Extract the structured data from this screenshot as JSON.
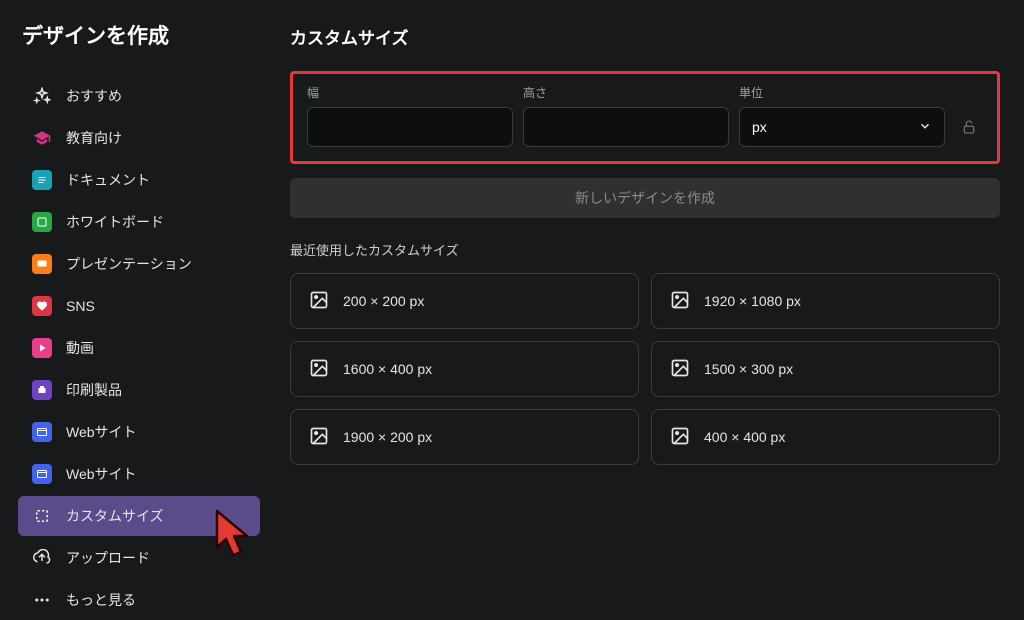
{
  "sidebar": {
    "title": "デザインを作成",
    "items": [
      {
        "label": "おすすめ",
        "icon": "sparkle",
        "color": "#e5e5e5"
      },
      {
        "label": "教育向け",
        "icon": "graduation",
        "color": "#d63384"
      },
      {
        "label": "ドキュメント",
        "icon": "document",
        "color": "#17a2b8"
      },
      {
        "label": "ホワイトボード",
        "icon": "whiteboard",
        "color": "#28a745"
      },
      {
        "label": "プレゼンテーション",
        "icon": "presentation",
        "color": "#fd7e14"
      },
      {
        "label": "SNS",
        "icon": "sns",
        "color": "#dc3545"
      },
      {
        "label": "動画",
        "icon": "video",
        "color": "#e83e8c"
      },
      {
        "label": "印刷製品",
        "icon": "print",
        "color": "#6f42c1"
      },
      {
        "label": "Webサイト",
        "icon": "website",
        "color": "#4263eb"
      },
      {
        "label": "Webサイト",
        "icon": "website",
        "color": "#4263eb"
      },
      {
        "label": "カスタムサイズ",
        "icon": "custom",
        "color": "#e5e5e5",
        "active": true
      },
      {
        "label": "アップロード",
        "icon": "upload",
        "color": "#e5e5e5"
      },
      {
        "label": "もっと見る",
        "icon": "more",
        "color": "#e5e5e5"
      }
    ]
  },
  "main": {
    "title": "カスタムサイズ",
    "fields": {
      "width_label": "幅",
      "height_label": "高さ",
      "unit_label": "単位",
      "unit_value": "px"
    },
    "create_button": "新しいデザインを作成",
    "recent_label": "最近使用したカスタムサイズ",
    "recent_items": [
      {
        "label": "200 × 200 px"
      },
      {
        "label": "1920 × 1080 px"
      },
      {
        "label": "1600 × 400 px"
      },
      {
        "label": "1500 × 300 px"
      },
      {
        "label": "1900 × 200 px"
      },
      {
        "label": "400 × 400 px"
      }
    ]
  }
}
